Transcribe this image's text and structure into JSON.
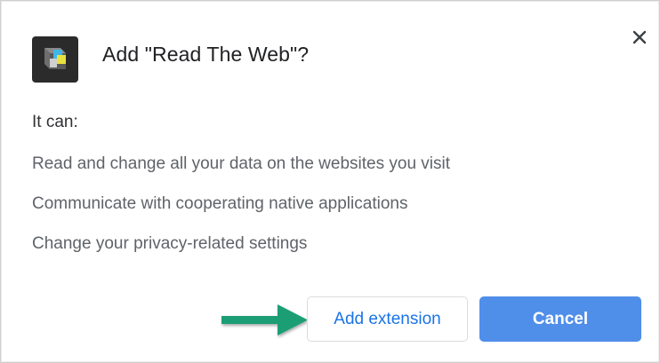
{
  "dialog": {
    "title": "Add \"Read The Web\"?",
    "extension_icon": "read-the-web-cube-icon",
    "close_icon": "close-icon",
    "intro": "It can:",
    "permissions": [
      "Read and change all your data on the websites you visit",
      "Communicate with cooperating native applications",
      "Change your privacy-related settings"
    ],
    "buttons": {
      "add_label": "Add extension",
      "cancel_label": "Cancel"
    },
    "annotation": {
      "arrow_icon": "right-arrow-icon",
      "arrow_color": "#1e9e74"
    }
  },
  "colors": {
    "accent": "#1a73e8",
    "cancel_bg": "#4f8ee9",
    "title_text": "#202124",
    "permission_text": "#5f6368"
  }
}
